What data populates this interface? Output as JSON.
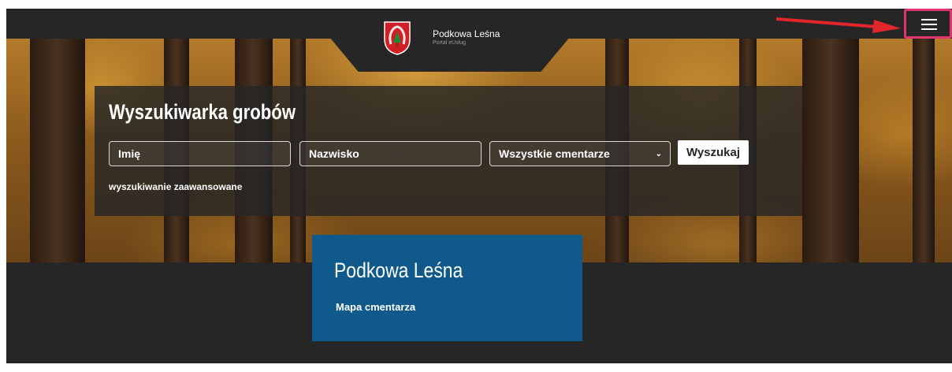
{
  "header": {
    "brand_name": "Podkowa Leśna",
    "brand_subtitle": "Portal eUsług",
    "menu_icon": "hamburger-menu-icon"
  },
  "search": {
    "title": "Wyszukiwarka grobów",
    "first_name_placeholder": "Imię",
    "last_name_placeholder": "Nazwisko",
    "cemetery_select_value": "Wszystkie cmentarze",
    "search_button": "Wyszukaj",
    "advanced_link": "wyszukiwanie zaawansowane"
  },
  "card": {
    "title": "Podkowa Leśna",
    "link": "Mapa cmentarza"
  },
  "colors": {
    "background": "#262626",
    "card_blue": "#0f5a8a",
    "highlight": "#e2336e",
    "arrow": "#e3262c"
  }
}
